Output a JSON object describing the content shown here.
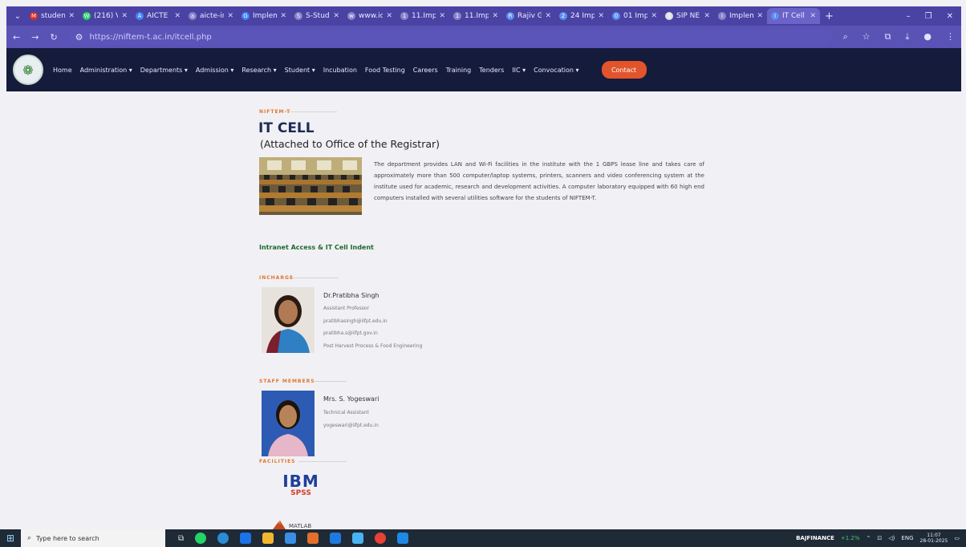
{
  "browser": {
    "tabs": [
      {
        "label": "studen",
        "color": "#d93025",
        "glyph": "M"
      },
      {
        "label": "(216) V",
        "color": "#25d366",
        "glyph": "W"
      },
      {
        "label": "AICTE",
        "color": "#4285f4",
        "glyph": "A"
      },
      {
        "label": "aicte-in",
        "color": "#8a84c9",
        "glyph": "a"
      },
      {
        "label": "Implem",
        "color": "#4285f4",
        "glyph": "G"
      },
      {
        "label": "S-Stud",
        "color": "#8a84c9",
        "glyph": "S"
      },
      {
        "label": "www.ict",
        "color": "#8a84c9",
        "glyph": "w"
      },
      {
        "label": "11.Imp",
        "color": "#8a84c9",
        "glyph": "1"
      },
      {
        "label": "11.Imp",
        "color": "#8a84c9",
        "glyph": "1"
      },
      {
        "label": "Rajiv G",
        "color": "#5b8def",
        "glyph": "R"
      },
      {
        "label": "24 Imp",
        "color": "#5b8def",
        "glyph": "2"
      },
      {
        "label": "01 Imp",
        "color": "#5b8def",
        "glyph": "0"
      },
      {
        "label": "SIP NE",
        "color": "#e0e0e0",
        "glyph": "S"
      },
      {
        "label": "Implem",
        "color": "#8a84c9",
        "glyph": "I"
      },
      {
        "label": "IT Cell",
        "color": "#5b8def",
        "glyph": "I",
        "active": true
      }
    ],
    "url": "https://niftem-t.ac.in/itcell.php"
  },
  "nav": {
    "items": [
      {
        "label": "Home"
      },
      {
        "label": "Administration ▾"
      },
      {
        "label": "Departments ▾"
      },
      {
        "label": "Admission ▾"
      },
      {
        "label": "Research ▾"
      },
      {
        "label": "Student ▾"
      },
      {
        "label": "Incubation"
      },
      {
        "label": "Food Testing"
      },
      {
        "label": "Careers"
      },
      {
        "label": "Training"
      },
      {
        "label": "Tenders"
      },
      {
        "label": "IIC ▾"
      },
      {
        "label": "Convocation ▾"
      },
      {
        "label": "",
        "faint": true
      }
    ],
    "contact_label": "Contact"
  },
  "page": {
    "eyebrow": "NIFTEM-T",
    "title": "IT CELL",
    "subtitle": "(Attached to Office of the Registrar)",
    "description": "The department provides LAN and Wi-Fi facilities in the institute with the 1 GBPS lease line and takes care of approximately more than 500 computer/laptop systems, printers, scanners and video conferencing system at the institute used for academic, research and development activities. A computer laboratory equipped with 60 high end computers installed with several utilities software for the students of NIFTEM-T.",
    "intranet_link": "Intranet Access & IT Cell Indent",
    "incharge_heading": "INCHARGE",
    "incharge": {
      "name": "Dr.Pratibha Singh",
      "designation": "Assistant Professor",
      "email1": "pratibhasingh@iifpt.edu.in",
      "email2": "pratibha.s@iifpt.gov.in",
      "department": "Post Harvest Process & Food Engineering"
    },
    "staff_heading": "STAFF MEMBERS",
    "staff": {
      "name": "Mrs. S. Yogeswari",
      "designation": "Technical Assistant",
      "email": "yogeswari@iifpt.edu.in"
    },
    "facilities_heading": "FACILITIES",
    "facilities": {
      "ibm": "IBM",
      "spss": "SPSS",
      "matlab": "MATLAB"
    }
  },
  "taskbar": {
    "search_placeholder": "Type here to search",
    "stock_label": "BAJFINANCE",
    "stock_change": "+1.2%",
    "lang": "ENG",
    "time": "11:07",
    "date": "28-01-2025"
  }
}
